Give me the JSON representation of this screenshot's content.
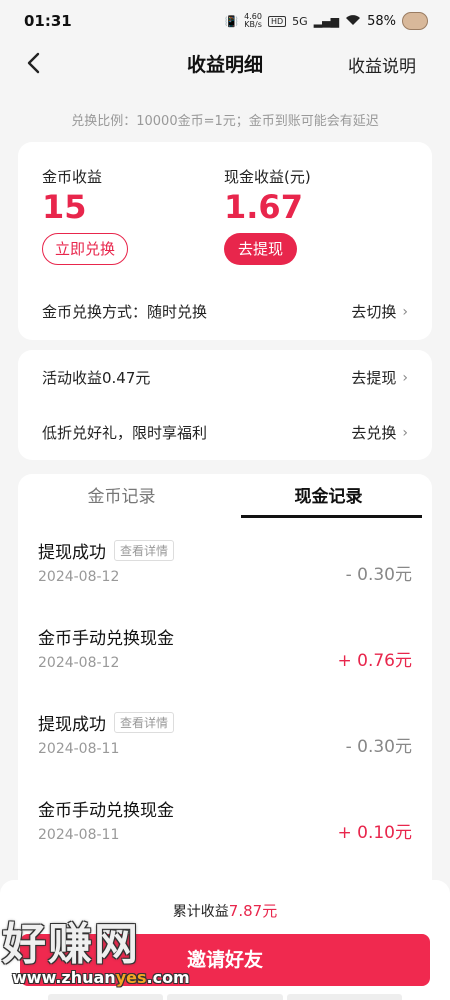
{
  "status_bar": {
    "time": "01:31",
    "net_speed_top": "4.60",
    "net_speed_unit": "KB/s",
    "hd_badge": "HD",
    "network": "5G",
    "battery": "58%"
  },
  "nav": {
    "title": "收益明细",
    "right_label": "收益说明"
  },
  "tip": "兑换比例：10000金币=1元；金币到账可能会有延迟",
  "balance": {
    "coin_label": "金币收益",
    "coin_value": "15",
    "coin_button": "立即兑换",
    "cash_label": "现金收益(元)",
    "cash_value": "1.67",
    "cash_button": "去提现",
    "exchange_mode_label": "金币兑换方式：随时兑换",
    "exchange_mode_action": "去切换"
  },
  "activity": {
    "rows": [
      {
        "label": "活动收益0.47元",
        "action": "去提现"
      },
      {
        "label": "低折兑好礼，限时享福利",
        "action": "去兑换"
      }
    ]
  },
  "records": {
    "tabs": [
      "金币记录",
      "现金记录"
    ],
    "active_tab": "现金记录",
    "items": [
      {
        "title": "提现成功",
        "detail": "查看详情",
        "date": "2024-08-12",
        "amount": "- 0.30元"
      },
      {
        "title": "金币手动兑换现金",
        "detail": "",
        "date": "2024-08-12",
        "amount": "+ 0.76元"
      },
      {
        "title": "提现成功",
        "detail": "查看详情",
        "date": "2024-08-11",
        "amount": "- 0.30元"
      },
      {
        "title": "金币手动兑换现金",
        "detail": "",
        "date": "2024-08-11",
        "amount": "+ 0.10元"
      }
    ]
  },
  "footer": {
    "total_label": "累计收益",
    "total_value": "7.87元",
    "invite_button": "邀请好友"
  },
  "watermark": {
    "main": "好赚网",
    "url_prefix": "www.zhuan",
    "url_highlight": "yes",
    "url_suffix": ".com"
  },
  "colors": {
    "accent": "#e8264c",
    "background": "#f5f5f5",
    "muted": "#999999"
  }
}
